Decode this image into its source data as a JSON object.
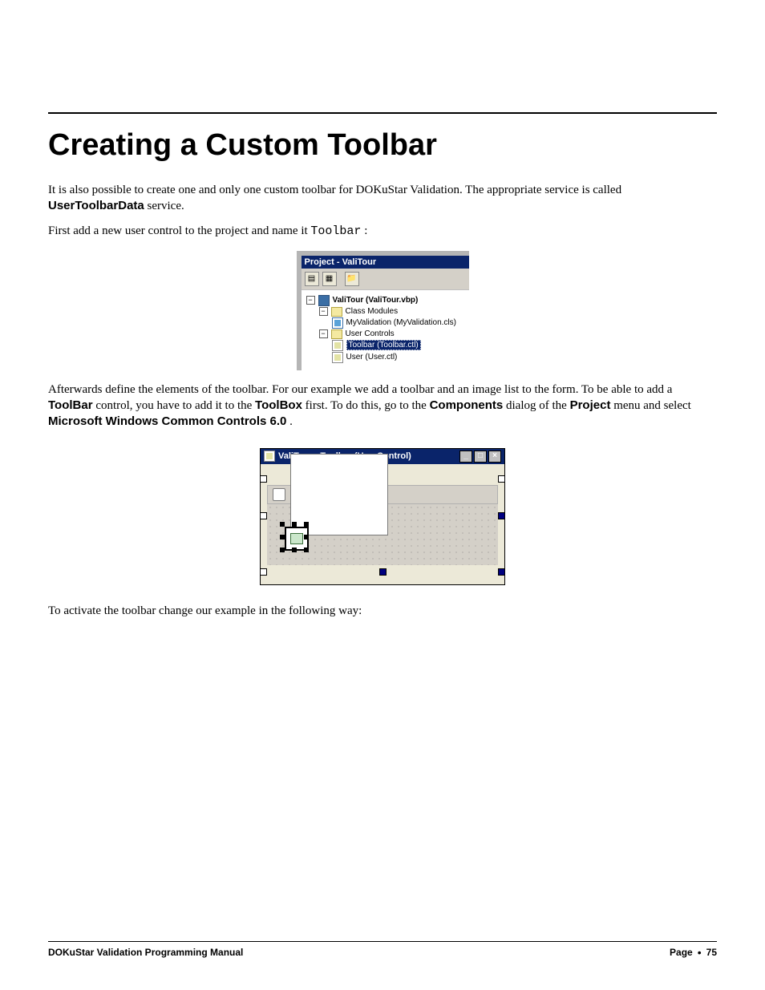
{
  "heading": "Creating a Custom Toolbar",
  "para1_a": "It is also possible to create one and only one custom toolbar for DOKuStar Validation. The appropriate service is called ",
  "para1_b_bold": "UserToolbarData",
  "para1_c": " service.",
  "para2_a": "First add a new user control to the project and name it ",
  "para2_code": "Toolbar",
  "para2_b": ":",
  "fig1": {
    "title": "Project - ValiTour",
    "root": "ValiTour (ValiTour.vbp)",
    "folder1": "Class Modules",
    "cls": "MyValidation (MyValidation.cls)",
    "folder2": "User Controls",
    "uc_sel": "Toolbar (Toolbar.ctl)",
    "uc2": "User (User.ctl)"
  },
  "para3_a": "Afterwards define the elements of the toolbar. For our example we add a toolbar and an image list to the form. To be able to add a ",
  "para3_b_bold": "ToolBar",
  "para3_c": " control, you have to add it to the ",
  "para3_d_bold": "ToolBox",
  "para3_e": " first. To do this, go to the ",
  "para3_f_bold": "Components",
  "para3_g": " dialog of the ",
  "para3_h_bold": "Project",
  "para3_i": " menu and select ",
  "para3_j_bold": "Microsoft Windows Common Controls 6.0",
  "para3_k": ".",
  "fig2": {
    "title": "ValiTour - Toolbar (UserControl)",
    "minimize": "_",
    "maximize": "□",
    "close": "×"
  },
  "para4": "To activate the toolbar change our example in the following way:",
  "footer": {
    "left": "DOKuStar Validation Programming Manual",
    "page_label": "Page",
    "bullet": "•",
    "page_number": "75"
  }
}
